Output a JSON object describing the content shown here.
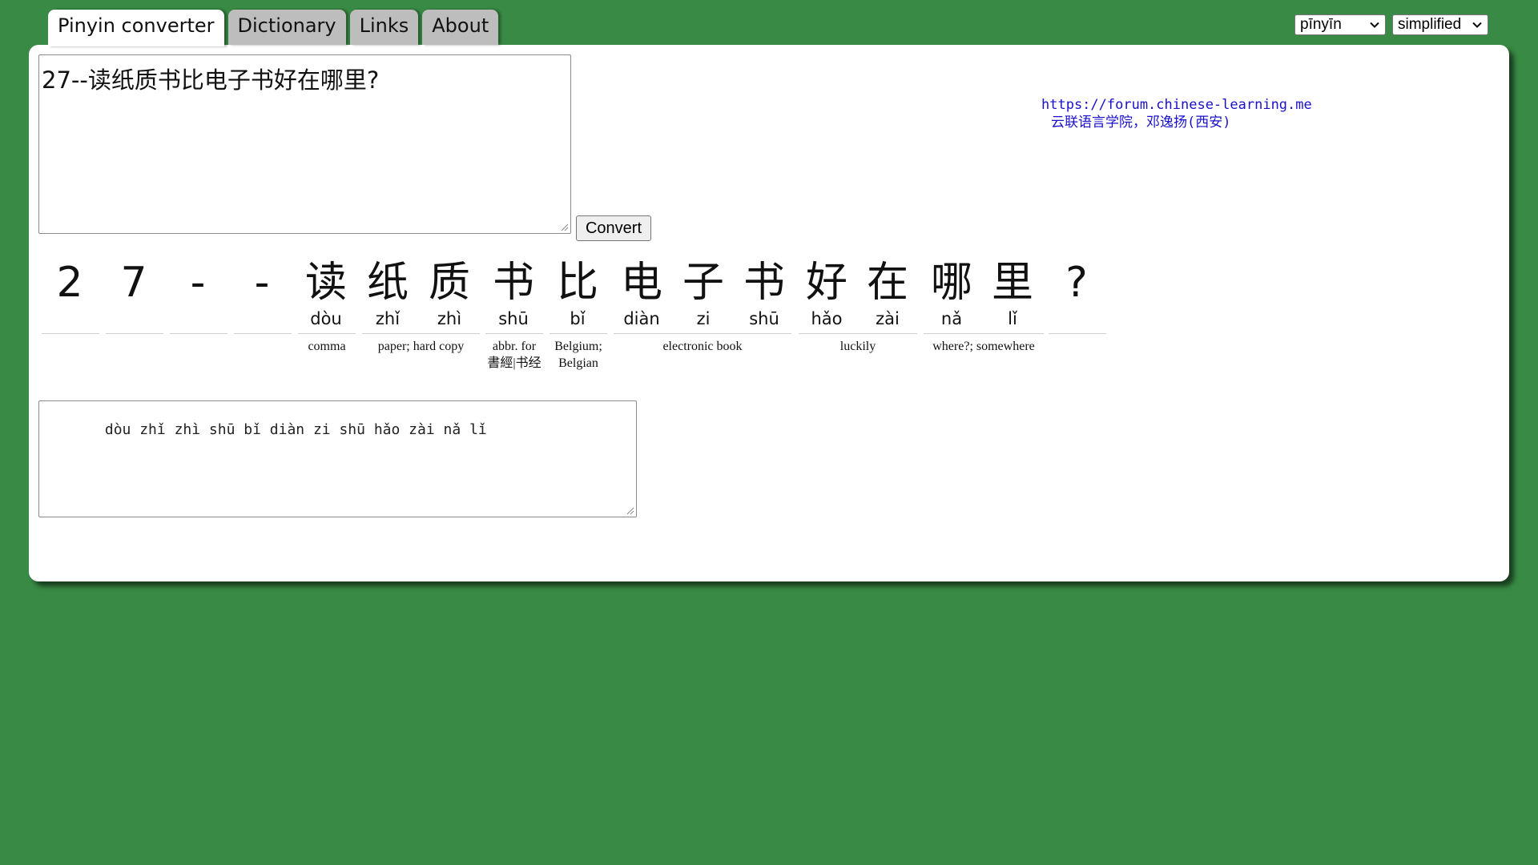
{
  "tabs": [
    {
      "label": "Pinyin converter",
      "active": true
    },
    {
      "label": "Dictionary",
      "active": false
    },
    {
      "label": "Links",
      "active": false
    },
    {
      "label": "About",
      "active": false
    }
  ],
  "selects": {
    "pinyin_mode": "pīnyīn",
    "script": "simplified"
  },
  "input": {
    "value": "27--读纸质书比电子书好在哪里?"
  },
  "convert_label": "Convert",
  "credits": {
    "url": "https://forum.chinese-learning.me",
    "name": "云联语言学院，邓逸扬(西安)"
  },
  "characters": [
    {
      "hanzi": "2",
      "pinyin": ""
    },
    {
      "hanzi": "7",
      "pinyin": ""
    },
    {
      "hanzi": "-",
      "pinyin": ""
    },
    {
      "hanzi": "-",
      "pinyin": ""
    },
    {
      "hanzi": "读",
      "pinyin": "dòu"
    },
    {
      "hanzi": "纸",
      "pinyin": "zhǐ"
    },
    {
      "hanzi": "质",
      "pinyin": "zhì"
    },
    {
      "hanzi": "书",
      "pinyin": "shū"
    },
    {
      "hanzi": "比",
      "pinyin": "bǐ"
    },
    {
      "hanzi": "电",
      "pinyin": "diàn"
    },
    {
      "hanzi": "子",
      "pinyin": "zi"
    },
    {
      "hanzi": "书",
      "pinyin": "shū"
    },
    {
      "hanzi": "好",
      "pinyin": "hǎo"
    },
    {
      "hanzi": "在",
      "pinyin": "zài"
    },
    {
      "hanzi": "哪",
      "pinyin": "nǎ"
    },
    {
      "hanzi": "里",
      "pinyin": "lǐ"
    },
    {
      "hanzi": "?",
      "pinyin": ""
    }
  ],
  "definitions": [
    "comma",
    "paper; hard copy",
    "abbr. for 書經|书经",
    "Belgium; Belgian",
    "electronic book",
    "luckily",
    "where?; somewhere"
  ],
  "output": {
    "value": "   dòu zhǐ zhì shū bǐ diàn zi shū hǎo zài nǎ lǐ"
  }
}
